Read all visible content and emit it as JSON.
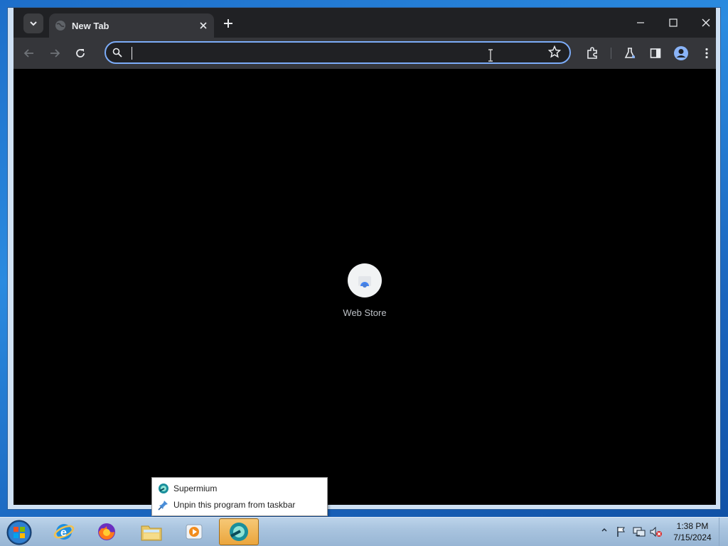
{
  "browser": {
    "tab_title": "New Tab",
    "omnibox_value": "",
    "omnibox_placeholder": ""
  },
  "shortcut": {
    "label": "Web Store"
  },
  "jump_list": {
    "items": [
      {
        "label": "Supermium",
        "icon": "supermium-icon"
      },
      {
        "label": "Unpin this program from taskbar",
        "icon": "unpin-icon"
      }
    ]
  },
  "taskbar": {
    "apps": [
      "start-orb",
      "internet-explorer-icon",
      "firefox-icon",
      "file-explorer-icon",
      "media-player-icon",
      "supermium-icon"
    ],
    "clock_time": "1:38 PM",
    "clock_date": "7/15/2024"
  },
  "colors": {
    "titlebar": "#202124",
    "toolbar": "#35363a",
    "omnibox_focus": "#7cacf8",
    "content_bg": "#000000"
  }
}
